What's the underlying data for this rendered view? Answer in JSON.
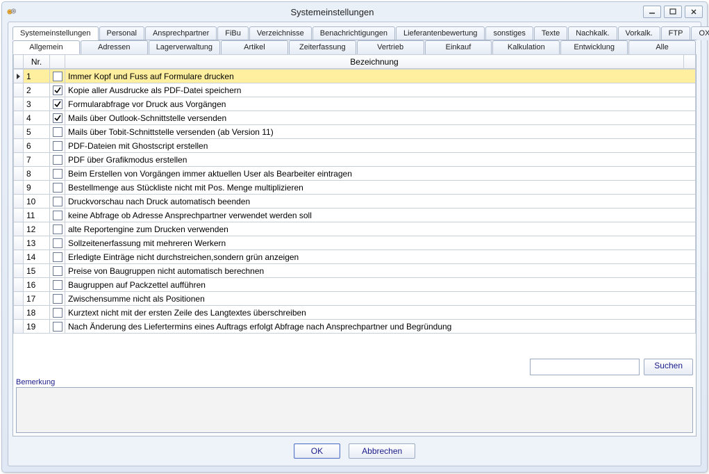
{
  "window": {
    "title": "Systemeinstellungen",
    "buttons": {
      "min": "minimize",
      "max": "maximize",
      "close": "close"
    }
  },
  "tabs_main": [
    {
      "id": "systemeinstellungen",
      "label": "Systemeinstellungen",
      "active": true
    },
    {
      "id": "personal",
      "label": "Personal"
    },
    {
      "id": "ansprechpartner",
      "label": "Ansprechpartner"
    },
    {
      "id": "fibu",
      "label": "FiBu"
    },
    {
      "id": "verzeichnisse",
      "label": "Verzeichnisse"
    },
    {
      "id": "benachrichtigungen",
      "label": "Benachrichtigungen"
    },
    {
      "id": "lieferantenbewertung",
      "label": "Lieferantenbewertung"
    },
    {
      "id": "sonstiges",
      "label": "sonstiges"
    },
    {
      "id": "texte",
      "label": "Texte"
    },
    {
      "id": "nachkalk",
      "label": "Nachkalk."
    },
    {
      "id": "vorkalk",
      "label": "Vorkalk."
    },
    {
      "id": "ftp",
      "label": "FTP"
    },
    {
      "id": "oxid",
      "label": "OXID"
    }
  ],
  "tabs_sub": [
    {
      "id": "allgemein",
      "label": "Allgemein",
      "active": true
    },
    {
      "id": "adressen",
      "label": "Adressen"
    },
    {
      "id": "lagerverwaltung",
      "label": "Lagerverwaltung"
    },
    {
      "id": "artikel",
      "label": "Artikel"
    },
    {
      "id": "zeiterfassung",
      "label": "Zeiterfassung"
    },
    {
      "id": "vertrieb",
      "label": "Vertrieb"
    },
    {
      "id": "einkauf",
      "label": "Einkauf"
    },
    {
      "id": "kalkulation",
      "label": "Kalkulation"
    },
    {
      "id": "entwicklung",
      "label": "Entwicklung"
    },
    {
      "id": "alle",
      "label": "Alle"
    }
  ],
  "grid": {
    "columns": {
      "nr": "Nr.",
      "desc": "Bezeichnung"
    },
    "rows": [
      {
        "nr": 1,
        "checked": false,
        "desc": "Immer Kopf und Fuss auf Formulare drucken",
        "selected": true
      },
      {
        "nr": 2,
        "checked": true,
        "desc": "Kopie aller Ausdrucke als PDF-Datei speichern"
      },
      {
        "nr": 3,
        "checked": true,
        "desc": "Formularabfrage vor Druck aus Vorgängen"
      },
      {
        "nr": 4,
        "checked": true,
        "desc": "Mails über Outlook-Schnittstelle versenden"
      },
      {
        "nr": 5,
        "checked": false,
        "desc": "Mails über Tobit-Schnittstelle versenden (ab Version 11)"
      },
      {
        "nr": 6,
        "checked": false,
        "desc": "PDF-Dateien mit Ghostscript erstellen"
      },
      {
        "nr": 7,
        "checked": false,
        "desc": "PDF über Grafikmodus erstellen"
      },
      {
        "nr": 8,
        "checked": false,
        "desc": "Beim Erstellen von Vorgängen immer aktuellen User als Bearbeiter eintragen"
      },
      {
        "nr": 9,
        "checked": false,
        "desc": "Bestellmenge aus Stückliste nicht mit Pos. Menge multiplizieren"
      },
      {
        "nr": 10,
        "checked": false,
        "desc": "Druckvorschau nach Druck automatisch beenden"
      },
      {
        "nr": 11,
        "checked": false,
        "desc": "keine Abfrage ob Adresse Ansprechpartner verwendet werden soll"
      },
      {
        "nr": 12,
        "checked": false,
        "desc": "alte Reportengine zum Drucken verwenden"
      },
      {
        "nr": 13,
        "checked": false,
        "desc": "Sollzeitenerfassung mit mehreren Werkern"
      },
      {
        "nr": 14,
        "checked": false,
        "desc": "Erledigte Einträge nicht durchstreichen,sondern grün anzeigen"
      },
      {
        "nr": 15,
        "checked": false,
        "desc": "Preise von Baugruppen nicht automatisch berechnen"
      },
      {
        "nr": 16,
        "checked": false,
        "desc": "Baugruppen auf Packzettel aufführen"
      },
      {
        "nr": 17,
        "checked": false,
        "desc": "Zwischensumme nicht als Positionen"
      },
      {
        "nr": 18,
        "checked": false,
        "desc": "Kurztext nicht mit der ersten Zeile des Langtextes überschreiben"
      },
      {
        "nr": 19,
        "checked": false,
        "desc": "Nach Änderung des Liefertermins eines Auftrags erfolgt Abfrage nach Ansprechpartner und Begründung"
      }
    ]
  },
  "search": {
    "value": "",
    "button": "Suchen"
  },
  "remark": {
    "label": "Bemerkung",
    "value": ""
  },
  "buttons": {
    "ok": "OK",
    "cancel": "Abbrechen"
  }
}
